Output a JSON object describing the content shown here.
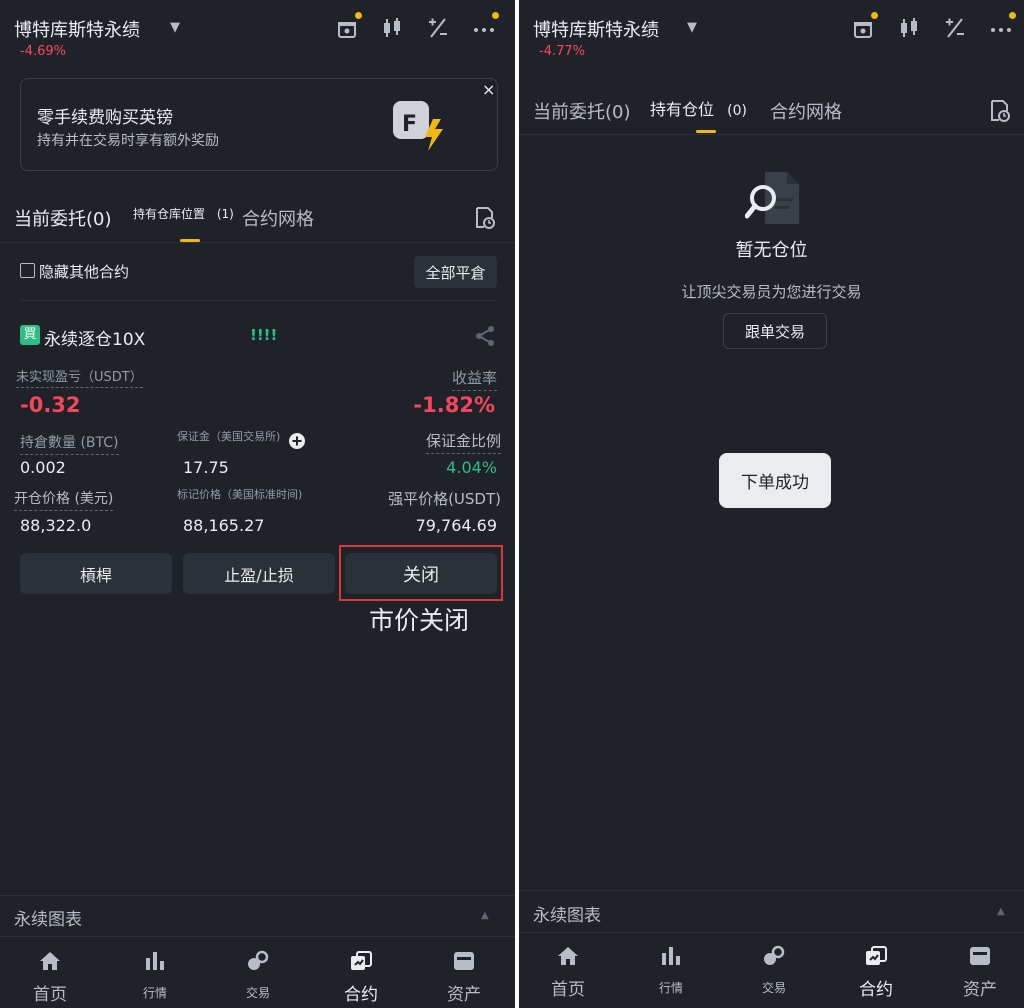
{
  "left": {
    "header": {
      "title": "博特库斯特永绩",
      "change": "-4.69%"
    },
    "promo": {
      "title": "零手续费购买英镑",
      "subtitle": "持有并在交易时享有额外奖励",
      "close": "×"
    },
    "tabs": [
      {
        "label": "当前委托(0)"
      },
      {
        "label": "持有仓库位置",
        "count": "(1)"
      },
      {
        "label": "合约网格"
      }
    ],
    "hide_other": "隐藏其他合约",
    "close_all": "全部平倉",
    "position": {
      "badge": "買",
      "name": "永续逐仓10X",
      "bars": "!!!!",
      "pnl_label": "未实现盈亏（USDT）",
      "pnl_value": "-0.32",
      "roi_label": "收益率",
      "roi_value": "-1.82%",
      "qty_label": "持倉數量 (BTC)",
      "qty_value": "0.002",
      "margin_label": "保证金（美国交易所)",
      "margin_value": "17.75",
      "margin_ratio_label": "保证金比例",
      "margin_ratio_value": "4.04%",
      "entry_label": "开仓价格 (美元)",
      "entry_value": "88,322.0",
      "mark_label": "标记价格（美国标准时间)",
      "mark_value": "88,165.27",
      "liq_label": "强平价格(USDT)",
      "liq_value": "79,764.69"
    },
    "buttons": {
      "leverage": "槓桿",
      "tpsl": "止盈/止损",
      "close": "关闭"
    },
    "annotation": "市价关闭",
    "footer": "永续图表"
  },
  "right": {
    "header": {
      "title": "博特库斯特永绩",
      "change": "-4.77%"
    },
    "tabs": [
      {
        "label": "当前委托(0)"
      },
      {
        "label": "持有仓位",
        "count": "(0)"
      },
      {
        "label": "合约网格"
      }
    ],
    "empty_title": "暂无仓位",
    "empty_sub": "让顶尖交易员为您进行交易",
    "copy_button": "跟单交易",
    "toast": "下单成功",
    "footer": "永续图表"
  },
  "nav": {
    "items": [
      {
        "label": "首页",
        "icon": "home-icon"
      },
      {
        "label": "行情",
        "icon": "market-icon"
      },
      {
        "label": "交易",
        "icon": "trade-icon"
      },
      {
        "label": "合约",
        "icon": "futures-icon"
      },
      {
        "label": "资产",
        "icon": "wallet-icon"
      }
    ]
  },
  "colors": {
    "background": "#1f2329",
    "accent": "#f0b90b",
    "negative": "#f6465d",
    "positive": "#2ebd85",
    "highlight_box": "#d9363e"
  }
}
